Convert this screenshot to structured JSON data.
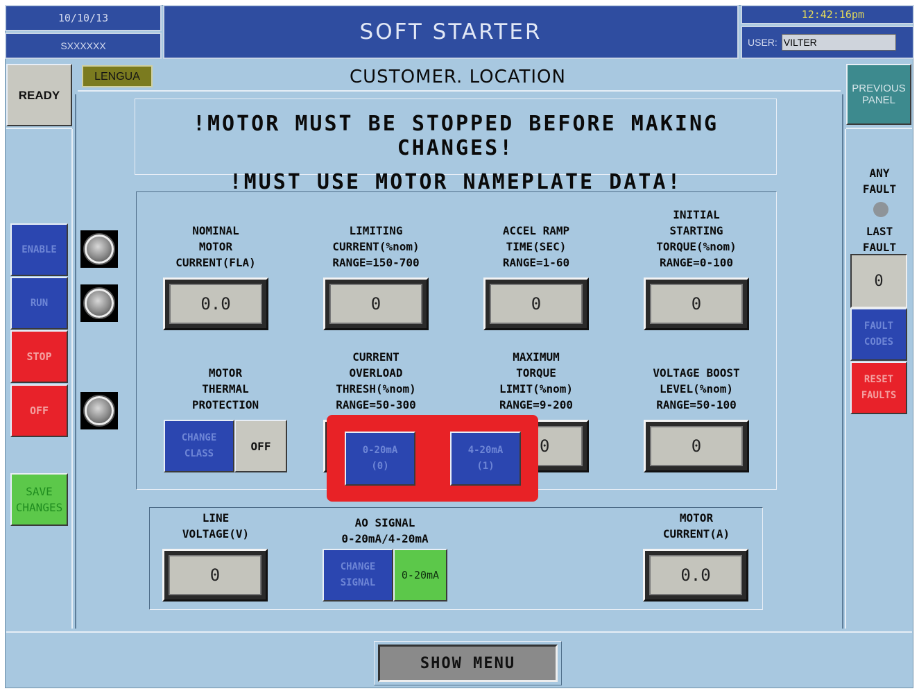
{
  "header": {
    "date": "10/10/13",
    "serial": "SXXXXXX",
    "title": "SOFT STARTER",
    "time": "12:42:16pm",
    "user_label": "USER:",
    "user_value": "VILTER"
  },
  "status": {
    "ready": "READY",
    "language": "LENGUA",
    "location": "CUSTOMER. LOCATION"
  },
  "warnings": {
    "line1": "!MOTOR MUST BE STOPPED BEFORE MAKING CHANGES!",
    "line2": "!MUST USE MOTOR NAMEPLATE DATA!"
  },
  "left_buttons": {
    "enable": "ENABLE",
    "run": "RUN",
    "stop": "STOP",
    "off": "OFF",
    "save_line1": "SAVE",
    "save_line2": "CHANGES"
  },
  "right_panel": {
    "previous_line1": "PREVIOUS",
    "previous_line2": "PANEL",
    "any_fault_line1": "ANY",
    "any_fault_line2": "FAULT",
    "last_fault_line1": "LAST",
    "last_fault_line2": "FAULT",
    "last_fault_value": "0",
    "fault_codes_line1": "FAULT",
    "fault_codes_line2": "CODES",
    "reset_line1": "RESET",
    "reset_line2": "FAULTS"
  },
  "params": {
    "nominal": {
      "l1": "NOMINAL",
      "l2": "MOTOR",
      "l3": "CURRENT(FLA)",
      "value": "0.0"
    },
    "limiting": {
      "l1": "LIMITING",
      "l2": "CURRENT(%nom)",
      "l3": "RANGE=150-700",
      "value": "0"
    },
    "accel": {
      "l1": "ACCEL RAMP",
      "l2": "TIME(SEC)",
      "l3": "RANGE=1-60",
      "value": "0"
    },
    "initial": {
      "l1": "INITIAL",
      "l2": "STARTING",
      "l3": "TORQUE(%nom)",
      "l4": "RANGE=0-100",
      "value": "0"
    },
    "thermal": {
      "l1": "MOTOR",
      "l2": "THERMAL",
      "l3": "PROTECTION",
      "btn1": "CHANGE",
      "btn2": "CLASS",
      "value": "OFF"
    },
    "overload": {
      "l1": "CURRENT",
      "l2": "OVERLOAD",
      "l3": "THRESH(%nom)",
      "l4": "RANGE=50-300"
    },
    "maxtorque": {
      "l1": "MAXIMUM",
      "l2": "TORQUE",
      "l3": "LIMIT(%nom)",
      "l4": "RANGE=9-200",
      "value": "0"
    },
    "boost": {
      "l1": "VOLTAGE BOOST",
      "l2": "LEVEL(%nom)",
      "l3": "RANGE=50-100",
      "value": "0"
    }
  },
  "popup": {
    "opt1_line1": "0-20mA",
    "opt1_line2": "(0)",
    "opt2_line1": "4-20mA",
    "opt2_line2": "(1)"
  },
  "bottom": {
    "line_voltage": {
      "l1": "LINE",
      "l2": "VOLTAGE(V)",
      "value": "0"
    },
    "ao_signal": {
      "l1": "AO SIGNAL",
      "l2": "0-20mA/4-20mA",
      "btn1": "CHANGE",
      "btn2": "SIGNAL",
      "value": "0-20mA"
    },
    "motor_current": {
      "l1": "MOTOR",
      "l2": "CURRENT(A)",
      "value": "0.0"
    }
  },
  "menu": {
    "show_menu": "SHOW MENU"
  },
  "colors": {
    "background": "#a8c8e0",
    "header_blue": "#2f4da0",
    "alert_red": "#e82226",
    "ok_green": "#5cc84a"
  }
}
